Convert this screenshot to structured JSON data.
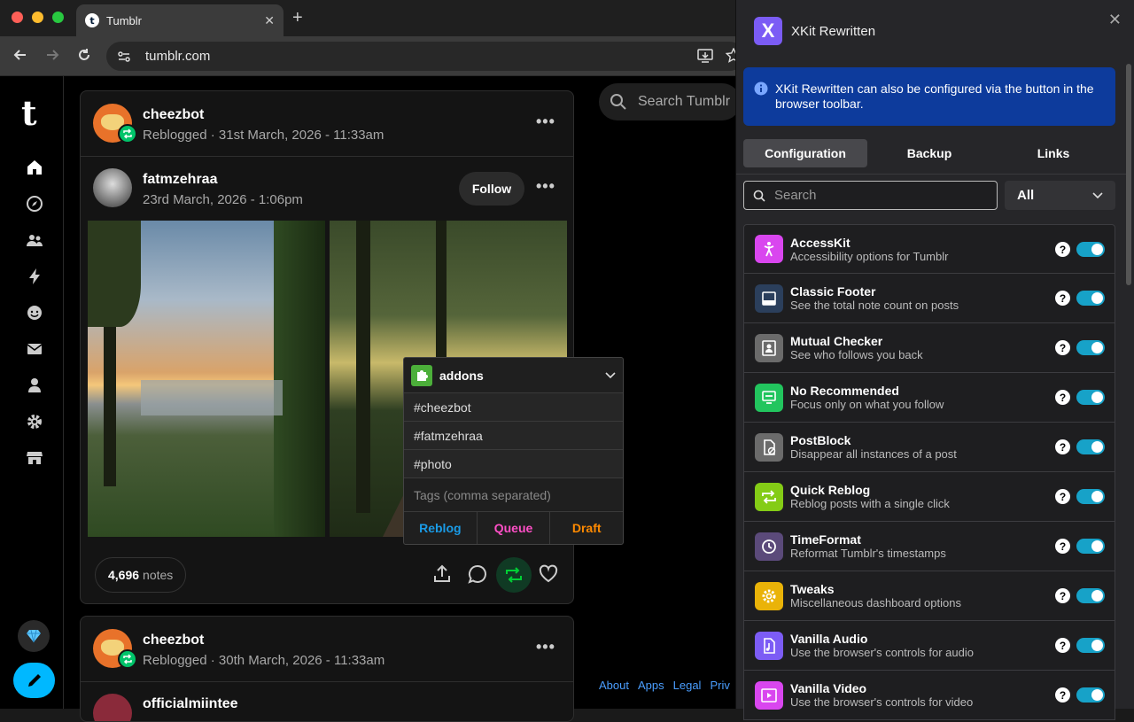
{
  "browser": {
    "tab_title": "Tumblr",
    "tab_favicon": "t",
    "url": "tumblr.com"
  },
  "tumblr": {
    "logo": "t",
    "search_placeholder": "Search Tumblr",
    "footer_links": [
      "About",
      "Apps",
      "Legal",
      "Priv"
    ],
    "post1": {
      "reblogger": "cheezbot",
      "reblog_meta": "Reblogged · 31st March, 2026 - 11:33am",
      "author": "fatmzehraa",
      "author_meta": "23rd March, 2026 - 1:06pm",
      "follow_label": "Follow",
      "notes_count": "4,696",
      "notes_label": "notes"
    },
    "post2": {
      "reblogger": "cheezbot",
      "reblog_meta": "Reblogged · 30th March, 2026 - 11:33am",
      "author": "officialmiintee"
    }
  },
  "quick_reblog": {
    "blog": "addons",
    "tags": [
      "#cheezbot",
      "#fatmzehraa",
      "#photo"
    ],
    "tags_placeholder": "Tags (comma separated)",
    "buttons": [
      {
        "label": "Reblog",
        "color": "#1a9be6"
      },
      {
        "label": "Queue",
        "color": "#ff4fc7"
      },
      {
        "label": "Draft",
        "color": "#ff8a00"
      }
    ]
  },
  "xkit": {
    "title": "XKit Rewritten",
    "logo": "X",
    "info": "XKit Rewritten can also be configured via the button in the browser toolbar.",
    "tabs": [
      "Configuration",
      "Backup",
      "Links"
    ],
    "search_placeholder": "Search",
    "filter_value": "All",
    "features": [
      {
        "name": "AccessKit",
        "desc": "Accessibility options for Tumblr",
        "icon": "accessibility-icon",
        "color": "#d946ef",
        "enabled": true
      },
      {
        "name": "Classic Footer",
        "desc": "See the total note count on posts",
        "icon": "footer-icon",
        "color": "#2b3f5c",
        "enabled": true
      },
      {
        "name": "Mutual Checker",
        "desc": "See who follows you back",
        "icon": "contact-card-icon",
        "color": "#6b6b6b",
        "enabled": true
      },
      {
        "name": "No Recommended",
        "desc": "Focus only on what you follow",
        "icon": "hide-icon",
        "color": "#22c55e",
        "enabled": true
      },
      {
        "name": "PostBlock",
        "desc": "Disappear all instances of a post",
        "icon": "block-post-icon",
        "color": "#6b6b6b",
        "enabled": true
      },
      {
        "name": "Quick Reblog",
        "desc": "Reblog posts with a single click",
        "icon": "reblog-icon",
        "color": "#84cc16",
        "enabled": true
      },
      {
        "name": "TimeFormat",
        "desc": "Reformat Tumblr's timestamps",
        "icon": "history-icon",
        "color": "#5b4a7a",
        "enabled": true
      },
      {
        "name": "Tweaks",
        "desc": "Miscellaneous dashboard options",
        "icon": "gear-icon",
        "color": "#eab308",
        "enabled": true
      },
      {
        "name": "Vanilla Audio",
        "desc": "Use the browser's controls for audio",
        "icon": "audio-file-icon",
        "color": "#7c5cf5",
        "enabled": true
      },
      {
        "name": "Vanilla Video",
        "desc": "Use the browser's controls for video",
        "icon": "video-icon",
        "color": "#d946ef",
        "enabled": true
      }
    ]
  }
}
